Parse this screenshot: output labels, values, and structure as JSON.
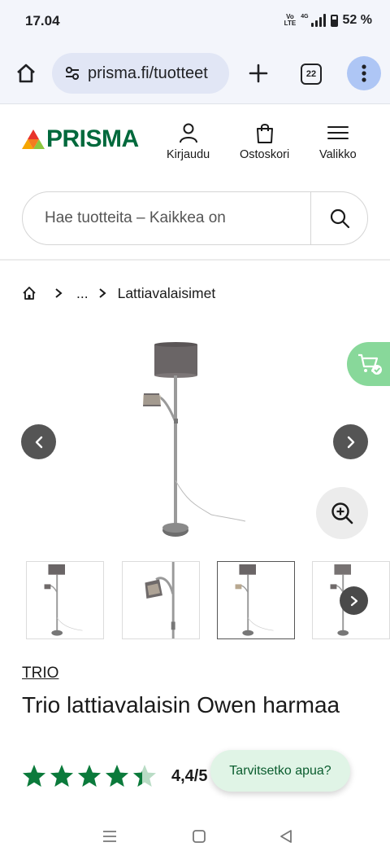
{
  "status_bar": {
    "time": "17.04",
    "volte_top": "Vo",
    "volte_bottom": "LTE",
    "network": "4G",
    "battery": "52 %"
  },
  "browser": {
    "url": "prisma.fi/tuotteet",
    "tab_count": "22",
    "icons": [
      "home-icon",
      "site-settings-icon",
      "plus-icon",
      "tabs-icon",
      "more-vert-icon"
    ]
  },
  "header": {
    "logo_text": "PRISMA",
    "login_label": "Kirjaudu",
    "cart_label": "Ostoskori",
    "menu_label": "Valikko"
  },
  "search": {
    "placeholder": "Hae tuotteita – Kaikkea on"
  },
  "breadcrumb": {
    "ellipsis": "...",
    "current": "Lattiavalaisimet"
  },
  "gallery": {
    "thumbnail_count": 4,
    "selected_thumbnail": 3
  },
  "product": {
    "brand": "TRIO",
    "title": "Trio lattiavalaisin Owen harmaa",
    "rating_stars": 4.4,
    "rating_text": "4,4/5"
  },
  "help": {
    "label": "Tarvitsetko apua?"
  },
  "colors": {
    "brand_green": "#00693c",
    "cart_fab": "#88d89a",
    "star": "#0b7a3b",
    "browser_menu": "#aec6f5"
  }
}
